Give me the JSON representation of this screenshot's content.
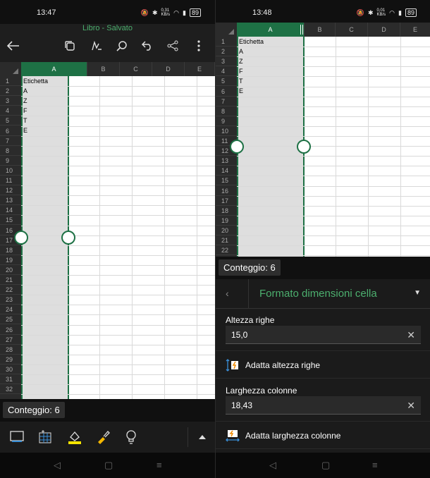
{
  "left": {
    "status": {
      "time": "13:47",
      "speed": "0,31\nKB/s",
      "battery": "89"
    },
    "title": "Libro - Salvato",
    "column_headers": [
      "A",
      "B",
      "C",
      "D",
      "E"
    ],
    "row_numbers": [
      "1",
      "2",
      "3",
      "4",
      "5",
      "6",
      "7",
      "8",
      "9",
      "10",
      "11",
      "12",
      "13",
      "14",
      "15",
      "16",
      "17",
      "18",
      "19",
      "20",
      "21",
      "22",
      "23",
      "24",
      "25",
      "26",
      "27",
      "28",
      "29",
      "30",
      "31",
      "32"
    ],
    "cells": [
      "Etichetta",
      "A",
      "Z",
      "F",
      "T",
      "E"
    ],
    "count_label": "Conteggio: 6"
  },
  "right": {
    "status": {
      "time": "13:48",
      "speed": "0,01\nKB/s",
      "battery": "89"
    },
    "column_headers": [
      "A",
      "B",
      "C",
      "D",
      "E"
    ],
    "row_numbers": [
      "1",
      "2",
      "3",
      "4",
      "5",
      "6",
      "7",
      "8",
      "9",
      "10",
      "11",
      "12",
      "13",
      "14",
      "15",
      "16",
      "17",
      "18",
      "19",
      "20",
      "21",
      "22"
    ],
    "cells": [
      "Etichetta",
      "A",
      "Z",
      "F",
      "T",
      "E"
    ],
    "count_label": "Conteggio: 6",
    "panel": {
      "title": "Formato dimensioni cella",
      "row_height_label": "Altezza righe",
      "row_height_value": "15,0",
      "fit_row_label": "Adatta altezza righe",
      "col_width_label": "Larghezza colonne",
      "col_width_value": "18,43",
      "fit_col_label": "Adatta larghezza colonne"
    }
  },
  "colors": {
    "accent": "#1e7145",
    "title_green": "#4caf6e",
    "selection": "#dedede"
  },
  "icons": [
    "back-arrow-icon",
    "copy-icon",
    "pen-icon",
    "search-icon",
    "undo-icon",
    "share-icon",
    "more-icon",
    "keyboard-icon",
    "cell-format-icon",
    "fill-color-icon",
    "brush-icon",
    "lightbulb-icon",
    "expand-up-icon",
    "nav-back-icon",
    "nav-home-icon",
    "nav-menu-icon"
  ]
}
